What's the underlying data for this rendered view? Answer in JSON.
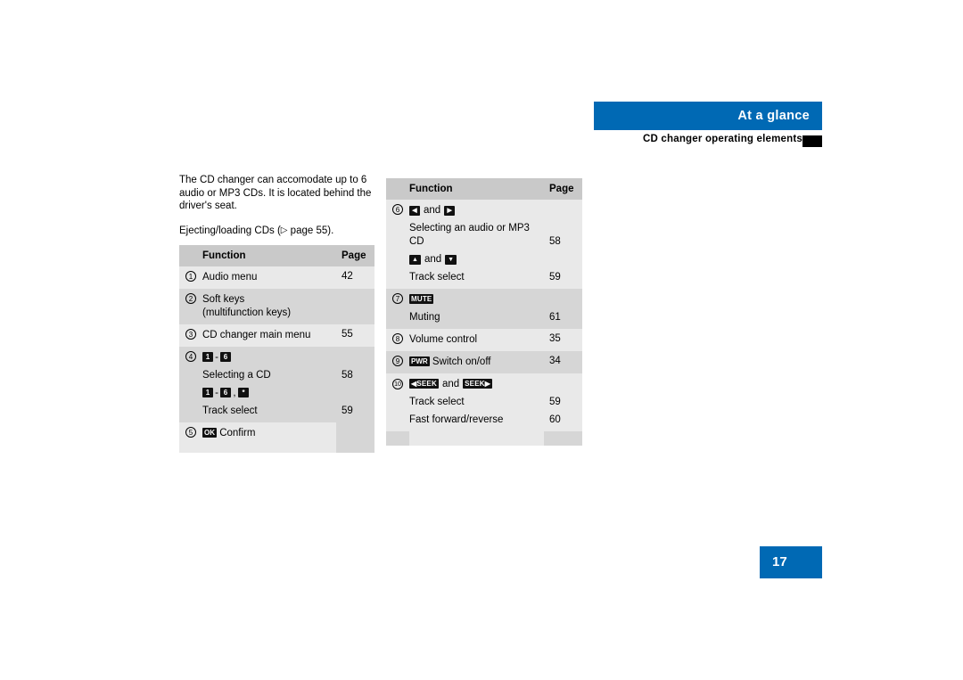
{
  "header": {
    "title": "At a glance",
    "subtitle": "CD changer operating elements",
    "accent_color": "#0069b4"
  },
  "intro": {
    "paragraph1": "The CD changer can accomodate up to 6 audio or MP3 CDs. It is located behind the driver's seat.",
    "paragraph2_pre": "Ejecting/loading CDs (",
    "paragraph2_arrow": "▷",
    "paragraph2_post": " page 55)."
  },
  "left_table": {
    "headers": {
      "function": "Function",
      "page": "Page"
    },
    "rows": [
      {
        "num": "1",
        "lines": [
          "Audio menu"
        ],
        "page": "42"
      },
      {
        "num": "2",
        "lines": [
          "Soft keys",
          "(multifunction keys)"
        ],
        "page": ""
      },
      {
        "num": "3",
        "lines": [
          "CD changer main menu"
        ],
        "page": "55"
      },
      {
        "num": "4",
        "keys_line1": [
          "1",
          "-",
          "6"
        ],
        "lines": [
          "Selecting a CD"
        ],
        "page": "58",
        "keys_line2": [
          "1",
          "-",
          "6",
          ",",
          "*"
        ],
        "lines2": [
          "Track select"
        ],
        "page2": "59"
      },
      {
        "num": "5",
        "key": "OK",
        "lines": [
          "Confirm"
        ],
        "page": ""
      }
    ]
  },
  "right_table": {
    "headers": {
      "function": "Function",
      "page": "Page"
    },
    "rows": [
      {
        "num": "6",
        "keys_line1": [
          "◀",
          "and",
          "▶"
        ],
        "lines": [
          "Selecting an audio or MP3",
          "CD"
        ],
        "page": "58",
        "keys_line2": [
          "▲",
          "and",
          "▼"
        ],
        "lines2": [
          "Track select"
        ],
        "page2": "59"
      },
      {
        "num": "7",
        "key": "MUTE",
        "lines": [
          "Muting"
        ],
        "page": "61"
      },
      {
        "num": "8",
        "lines": [
          "Volume control"
        ],
        "page": "35"
      },
      {
        "num": "9",
        "key": "PWR",
        "lines": [
          "Switch on/off"
        ],
        "page": "34"
      },
      {
        "num": "10",
        "keys_line1": [
          "◀SEEK",
          "and",
          "SEEK▶"
        ],
        "lines": [
          "Track select"
        ],
        "page": "59",
        "lines2": [
          "Fast forward/reverse"
        ],
        "page2": "60"
      }
    ]
  },
  "page_number": "17"
}
